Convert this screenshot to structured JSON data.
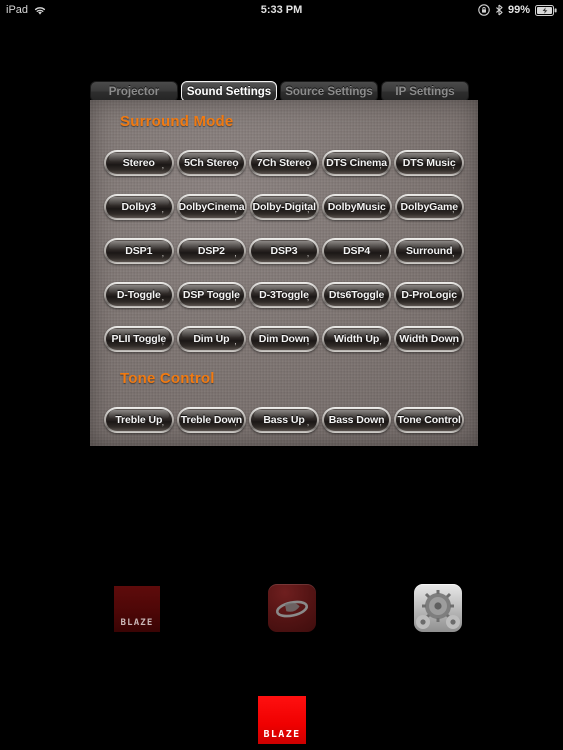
{
  "status_bar": {
    "carrier_label": "iPad",
    "wifi_icon": "wifi-icon",
    "time": "5:33 PM",
    "rotation_lock_icon": "rotation-lock-icon",
    "bluetooth_icon": "bluetooth-icon",
    "battery_percent": "99%",
    "battery_icon": "battery-charging-icon"
  },
  "tabs": [
    {
      "label": "Projector",
      "selected": false
    },
    {
      "label": "Sound Settings",
      "selected": true
    },
    {
      "label": "Source Settings",
      "selected": false
    },
    {
      "label": "IP Settings",
      "selected": false
    }
  ],
  "colors": {
    "accent_orange": "#f07a12",
    "panel_bg": "#7c7370",
    "button_face": "#2a2523",
    "button_bezel": "#cfcdca",
    "dock_red": "#ef0000"
  },
  "panel": {
    "sections": [
      {
        "title": "Surround Mode"
      },
      {
        "title": "Tone Control"
      }
    ],
    "rows": [
      {
        "buttons": [
          "Stereo",
          "5Ch Stereo",
          "7Ch Stereo",
          "DTS Cinema",
          "DTS Music"
        ]
      },
      {
        "buttons": [
          "Dolby3",
          "DolbyCinema",
          "Dolby-Digital",
          "DolbyMusic",
          "DolbyGame"
        ]
      },
      {
        "buttons": [
          "DSP1",
          "DSP2",
          "DSP3",
          "DSP4",
          "Surround"
        ]
      },
      {
        "buttons": [
          "D-Toggle",
          "DSP Toggle",
          "D-3Toggle",
          "Dts6Toggle",
          "D-ProLogic"
        ]
      },
      {
        "buttons": [
          "PLII Toggle",
          "Dim Up",
          "Dim Down",
          "Width Up",
          "Width Down"
        ]
      },
      {
        "buttons": [
          "Treble Up",
          "Treble Down",
          "Bass Up",
          "Bass Down",
          "Tone Control"
        ]
      }
    ]
  },
  "home_icons": [
    {
      "name": "blaze-app-icon",
      "label": "BLAZE"
    },
    {
      "name": "bluray-app-icon",
      "label": ""
    },
    {
      "name": "settings-app-icon",
      "label": ""
    }
  ],
  "dock": {
    "icons": [
      {
        "name": "blaze-dock-icon",
        "label": "BLAZE"
      }
    ]
  }
}
